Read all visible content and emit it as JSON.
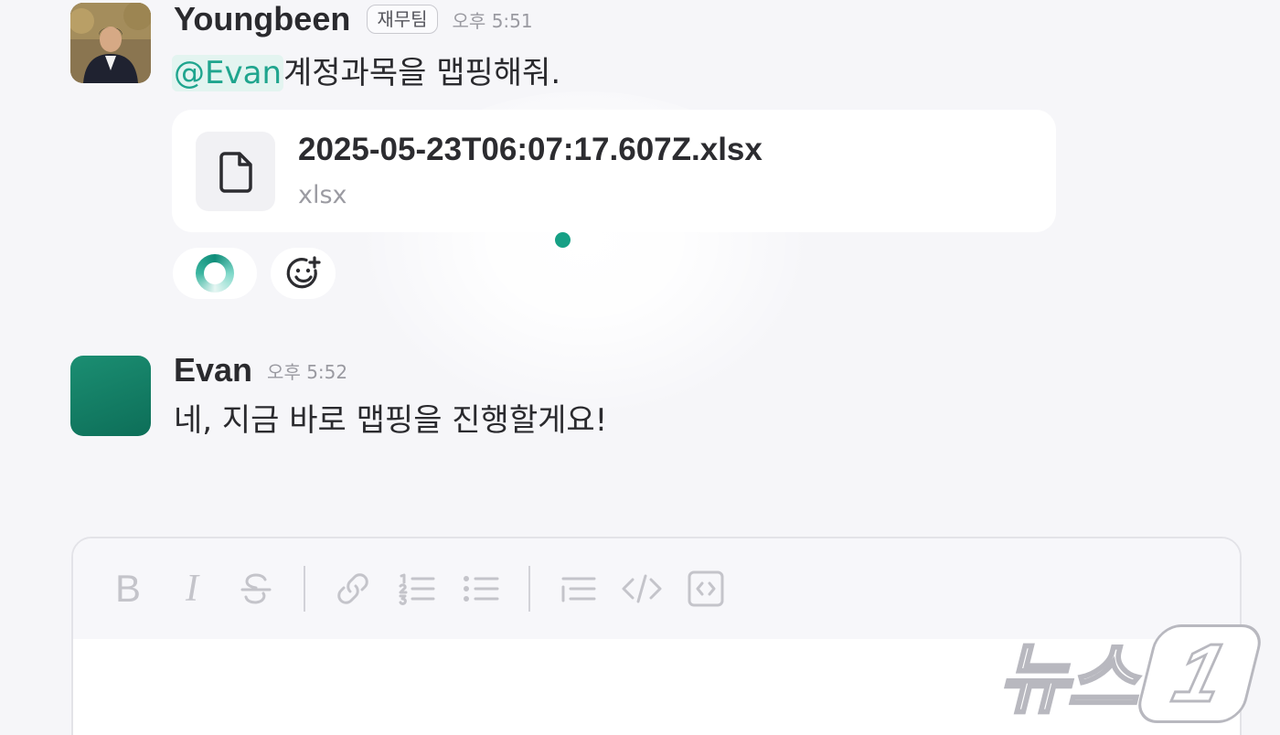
{
  "messages": [
    {
      "sender": "Youngbeen",
      "team": "재무팀",
      "time": "오후 5:51",
      "mention": "@Evan",
      "text": "계정과목을 맵핑해줘.",
      "attachment": {
        "file_name": "2025-05-23T06:07:17.607Z.xlsx",
        "file_type": "xlsx",
        "icon": "document-icon"
      },
      "reactions": [
        {
          "icon": "loading-ring-icon"
        },
        {
          "icon": "add-reaction-icon"
        }
      ]
    },
    {
      "sender": "Evan",
      "time": "오후 5:52",
      "text": "네, 지금 바로 맵핑을 진행할게요!"
    }
  ],
  "composer": {
    "toolbar": [
      {
        "icon": "bold-icon"
      },
      {
        "icon": "italic-icon"
      },
      {
        "icon": "strikethrough-icon"
      },
      {
        "icon": "link-icon"
      },
      {
        "icon": "ordered-list-icon"
      },
      {
        "icon": "bullet-list-icon"
      },
      {
        "icon": "blockquote-icon"
      },
      {
        "icon": "code-icon"
      },
      {
        "icon": "code-block-icon"
      }
    ],
    "input_value": ""
  },
  "watermark": {
    "text": "뉴스",
    "mark": "1"
  },
  "colors": {
    "accent": "#16a085",
    "mention_text": "#1fa58e",
    "mention_bg": "#e3f4f0",
    "evan_avatar": "#137f66"
  }
}
